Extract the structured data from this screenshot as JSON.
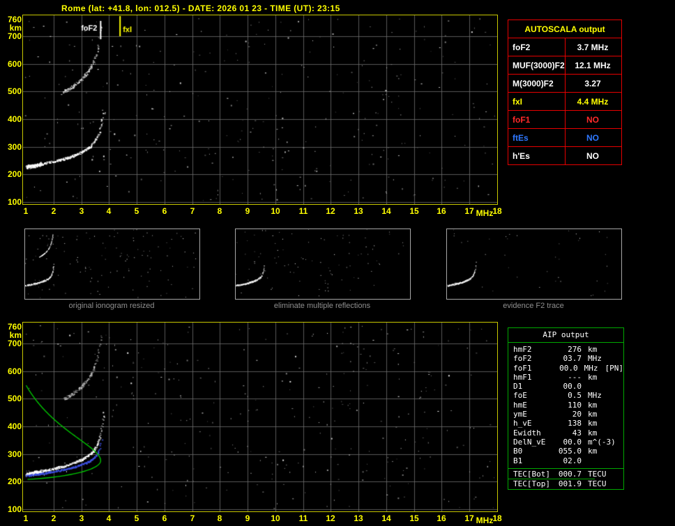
{
  "header": {
    "title": "Rome (lat: +41.8, lon: 012.5) - DATE: 2026 01 23 - TIME (UT): 23:15"
  },
  "colors": {
    "axis": "#ffff00",
    "plot_border": "#c8c800",
    "grid": "#6e6e6e",
    "table_border": "#e60000",
    "aip_border": "#00a800",
    "trace_white": "#ffffff",
    "fit_blue": "#3c50e0",
    "profile_green": "#00c400"
  },
  "plots": {
    "x_ticks": [
      "1",
      "2",
      "3",
      "4",
      "5",
      "6",
      "7",
      "8",
      "9",
      "10",
      "11",
      "12",
      "13",
      "14",
      "15",
      "16",
      "17",
      "18"
    ],
    "x_unit": "MHz",
    "y_ticks": [
      "760",
      "700",
      "600",
      "500",
      "400",
      "300",
      "200",
      "100"
    ],
    "y_unit": "km",
    "x_range_mhz": [
      1,
      18
    ],
    "y_range_km": [
      100,
      760
    ],
    "markers": {
      "foF2": {
        "label": "foF2",
        "mhz": 3.7
      },
      "fxI": {
        "label": "fxI",
        "mhz": 4.4
      }
    }
  },
  "autoscala": {
    "title": "AUTOSCALA output",
    "rows": [
      {
        "label": "foF2",
        "value": "3.7 MHz",
        "color": "#ffffff"
      },
      {
        "label": "MUF(3000)F2",
        "value": "12.1 MHz",
        "color": "#ffffff"
      },
      {
        "label": "M(3000)F2",
        "value": "3.27",
        "color": "#ffffff"
      },
      {
        "label": "fxI",
        "value": "4.4 MHz",
        "color": "#ffff00"
      },
      {
        "label": "foF1",
        "value": "NO",
        "color": "#ff2a2a"
      },
      {
        "label": "ftEs",
        "value": "NO",
        "color": "#2f78ff"
      },
      {
        "label": "h'Es",
        "value": "NO",
        "color": "#ffffff"
      }
    ]
  },
  "thumbnails": [
    {
      "caption": "original ionogram resized"
    },
    {
      "caption": "eliminate multiple reflections"
    },
    {
      "caption": "evidence F2 trace"
    }
  ],
  "aip": {
    "title": "AIP output",
    "rows": [
      {
        "name": "hmF2",
        "value": "276",
        "unit": "km"
      },
      {
        "name": "foF2",
        "value": "03.7",
        "unit": "MHz"
      },
      {
        "name": "foF1",
        "value": "00.0",
        "unit": "MHz",
        "extra": "[PN]"
      },
      {
        "name": "hmF1",
        "value": "---",
        "unit": "km"
      },
      {
        "name": "D1",
        "value": "00.0",
        "unit": ""
      },
      {
        "name": "foE",
        "value": "0.5",
        "unit": "MHz"
      },
      {
        "name": "hmE",
        "value": "110",
        "unit": "km"
      },
      {
        "name": "ymE",
        "value": "20",
        "unit": "km"
      },
      {
        "name": "h_vE",
        "value": "138",
        "unit": "km"
      },
      {
        "name": "Ewidth",
        "value": "43",
        "unit": "km"
      },
      {
        "name": "DelN_vE",
        "value": "00.0",
        "unit": "m^(-3)"
      },
      {
        "name": "B0",
        "value": "055.0",
        "unit": "km"
      },
      {
        "name": "B1",
        "value": "02.0",
        "unit": ""
      },
      {
        "name": "TEC[Bot]",
        "value": "000.7",
        "unit": "TECU",
        "sep": true,
        "subline": true
      },
      {
        "name": "TEC[Top]",
        "value": "001.9",
        "unit": "TECU"
      }
    ]
  }
}
